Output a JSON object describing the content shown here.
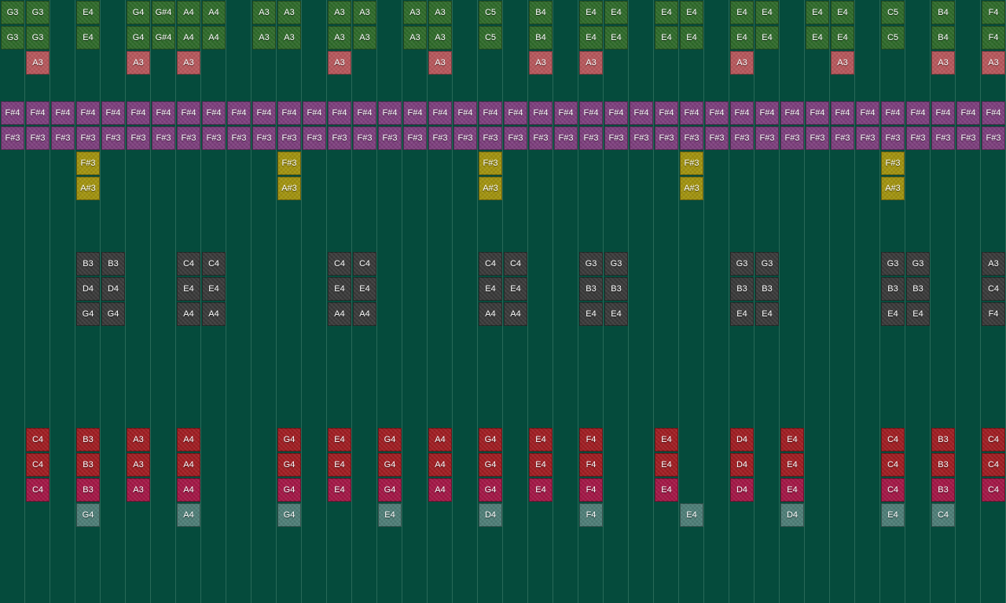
{
  "colors": {
    "background": "#054b3c",
    "grid_line": "#2f6e5d",
    "green": "#2f6b2a",
    "pink": "#b8585c",
    "purple": "#7e3f7e",
    "olive": "#a3940f",
    "gray": "#3a3a3a",
    "red": "#a11d22",
    "magenta": "#a51747",
    "slate": "#4f7f78"
  },
  "rows": [
    {
      "color": "green",
      "cells": [
        "G3",
        "G3",
        "",
        "E4",
        "",
        "G4",
        "G#4",
        "A4",
        "A4",
        "",
        "A3",
        "A3",
        "",
        "A3",
        "A3",
        "",
        "A3",
        "A3",
        "",
        "C5",
        "",
        "B4",
        "",
        "E4",
        "E4",
        "",
        "E4",
        "E4",
        "",
        "E4",
        "E4",
        "",
        "E4",
        "E4",
        "",
        "C5",
        "",
        "B4",
        "",
        "F4"
      ]
    },
    {
      "color": "green",
      "cells": [
        "G3",
        "G3",
        "",
        "E4",
        "",
        "G4",
        "G#4",
        "A4",
        "A4",
        "",
        "A3",
        "A3",
        "",
        "A3",
        "A3",
        "",
        "A3",
        "A3",
        "",
        "C5",
        "",
        "B4",
        "",
        "E4",
        "E4",
        "",
        "E4",
        "E4",
        "",
        "E4",
        "E4",
        "",
        "E4",
        "E4",
        "",
        "C5",
        "",
        "B4",
        "",
        "F4"
      ]
    },
    {
      "color": "pink",
      "cells": [
        "",
        "A3",
        "",
        "",
        "",
        "A3",
        "",
        "A3",
        "",
        "",
        "",
        "",
        "",
        "A3",
        "",
        "",
        "",
        "A3",
        "",
        "",
        "",
        "A3",
        "",
        "A3",
        "",
        "",
        "",
        "",
        "",
        "A3",
        "",
        "",
        "",
        "A3",
        "",
        "",
        "",
        "A3",
        "",
        "A3"
      ]
    },
    {
      "color": "purple",
      "cells": []
    },
    {
      "color": "purple",
      "cells": [
        "F#4",
        "F#4",
        "F#4",
        "F#4",
        "F#4",
        "F#4",
        "F#4",
        "F#4",
        "F#4",
        "F#4",
        "F#4",
        "F#4",
        "F#4",
        "F#4",
        "F#4",
        "F#4",
        "F#4",
        "F#4",
        "F#4",
        "F#4",
        "F#4",
        "F#4",
        "F#4",
        "F#4",
        "F#4",
        "F#4",
        "F#4",
        "F#4",
        "F#4",
        "F#4",
        "F#4",
        "F#4",
        "F#4",
        "F#4",
        "F#4",
        "F#4",
        "F#4",
        "F#4",
        "F#4",
        "F#4"
      ]
    },
    {
      "color": "purple",
      "cells": [
        "F#3",
        "F#3",
        "F#3",
        "F#3",
        "F#3",
        "F#3",
        "F#3",
        "F#3",
        "F#3",
        "F#3",
        "F#3",
        "F#3",
        "F#3",
        "F#3",
        "F#3",
        "F#3",
        "F#3",
        "F#3",
        "F#3",
        "F#3",
        "F#3",
        "F#3",
        "F#3",
        "F#3",
        "F#3",
        "F#3",
        "F#3",
        "F#3",
        "F#3",
        "F#3",
        "F#3",
        "F#3",
        "F#3",
        "F#3",
        "F#3",
        "F#3",
        "F#3",
        "F#3",
        "F#3",
        "F#3"
      ]
    },
    {
      "color": "olive",
      "cells": [
        "",
        "",
        "",
        "F#3",
        "",
        "",
        "",
        "",
        "",
        "",
        "",
        "F#3",
        "",
        "",
        "",
        "",
        "",
        "",
        "",
        "F#3",
        "",
        "",
        "",
        "",
        "",
        "",
        "",
        "F#3",
        "",
        "",
        "",
        "",
        "",
        "",
        "",
        "F#3",
        "",
        "",
        "",
        ""
      ]
    },
    {
      "color": "olive",
      "cells": [
        "",
        "",
        "",
        "A#3",
        "",
        "",
        "",
        "",
        "",
        "",
        "",
        "A#3",
        "",
        "",
        "",
        "",
        "",
        "",
        "",
        "A#3",
        "",
        "",
        "",
        "",
        "",
        "",
        "",
        "A#3",
        "",
        "",
        "",
        "",
        "",
        "",
        "",
        "A#3",
        "",
        "",
        "",
        ""
      ]
    },
    {
      "color": "gray",
      "cells": []
    },
    {
      "color": "gray",
      "cells": []
    },
    {
      "color": "gray",
      "cells": [
        "",
        "",
        "",
        "B3",
        "B3",
        "",
        "",
        "C4",
        "C4",
        "",
        "",
        "",
        "",
        "C4",
        "C4",
        "",
        "",
        "",
        "",
        "C4",
        "C4",
        "",
        "",
        "G3",
        "G3",
        "",
        "",
        "",
        "",
        "G3",
        "G3",
        "",
        "",
        "",
        "",
        "G3",
        "G3",
        "",
        "",
        "A3"
      ]
    },
    {
      "color": "gray",
      "cells": [
        "",
        "",
        "",
        "D4",
        "D4",
        "",
        "",
        "E4",
        "E4",
        "",
        "",
        "",
        "",
        "E4",
        "E4",
        "",
        "",
        "",
        "",
        "E4",
        "E4",
        "",
        "",
        "B3",
        "B3",
        "",
        "",
        "",
        "",
        "B3",
        "B3",
        "",
        "",
        "",
        "",
        "B3",
        "B3",
        "",
        "",
        "C4"
      ]
    },
    {
      "color": "gray",
      "cells": [
        "",
        "",
        "",
        "G4",
        "G4",
        "",
        "",
        "A4",
        "A4",
        "",
        "",
        "",
        "",
        "A4",
        "A4",
        "",
        "",
        "",
        "",
        "A4",
        "A4",
        "",
        "",
        "E4",
        "E4",
        "",
        "",
        "",
        "",
        "E4",
        "E4",
        "",
        "",
        "",
        "",
        "E4",
        "E4",
        "",
        "",
        "F4"
      ]
    },
    {
      "color": "gray",
      "cells": []
    },
    {
      "color": "gray",
      "cells": []
    },
    {
      "color": "gray",
      "cells": []
    },
    {
      "color": "gray",
      "cells": []
    },
    {
      "color": "red",
      "cells": [
        "",
        "C4",
        "",
        "B3",
        "",
        "A3",
        "",
        "A4",
        "",
        "",
        "",
        "G4",
        "",
        "E4",
        "",
        "G4",
        "",
        "A4",
        "",
        "G4",
        "",
        "E4",
        "",
        "F4",
        "",
        "",
        "E4",
        "",
        "",
        "D4",
        "",
        "E4",
        "",
        "",
        "",
        "C4",
        "",
        "B3",
        "",
        "C4"
      ]
    },
    {
      "color": "red",
      "cells": [
        "",
        "C4",
        "",
        "B3",
        "",
        "A3",
        "",
        "A4",
        "",
        "",
        "",
        "G4",
        "",
        "E4",
        "",
        "G4",
        "",
        "A4",
        "",
        "G4",
        "",
        "E4",
        "",
        "F4",
        "",
        "",
        "E4",
        "",
        "",
        "D4",
        "",
        "E4",
        "",
        "",
        "",
        "C4",
        "",
        "B3",
        "",
        "C4"
      ]
    },
    {
      "color": "magenta",
      "cells": [
        "",
        "C4",
        "",
        "B3",
        "",
        "A3",
        "",
        "A4",
        "",
        "",
        "",
        "G4",
        "",
        "E4",
        "",
        "G4",
        "",
        "A4",
        "",
        "G4",
        "",
        "E4",
        "",
        "F4",
        "",
        "",
        "E4",
        "",
        "",
        "D4",
        "",
        "E4",
        "",
        "",
        "",
        "C4",
        "",
        "B3",
        "",
        "C4"
      ]
    },
    {
      "color": "slate",
      "cells": [
        "",
        "",
        "",
        "G4",
        "",
        "",
        "",
        "A4",
        "",
        "",
        "",
        "G4",
        "",
        "",
        "",
        "E4",
        "",
        "",
        "",
        "D4",
        "",
        "",
        "",
        "F4",
        "",
        "",
        "",
        "E4",
        "",
        "",
        "",
        "D4",
        "",
        "",
        "",
        "E4",
        "",
        "C4",
        "",
        ""
      ]
    }
  ]
}
